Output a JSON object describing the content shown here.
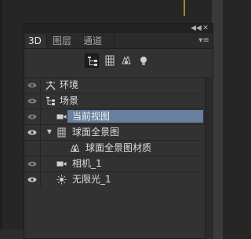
{
  "colors": {
    "background": "#262626",
    "panel": "#323232",
    "selection": "#6a7f9d",
    "text": "#dedede"
  },
  "panel": {
    "collapse_icon": "collapse-icon",
    "close_icon": "close-icon",
    "menu_icon": "panel-menu-icon"
  },
  "tabs": [
    {
      "label": "3D",
      "active": true
    },
    {
      "label": "图层",
      "active": false
    },
    {
      "label": "通道",
      "active": false
    }
  ],
  "filters": [
    {
      "icon": "whole-scene-icon",
      "active": true
    },
    {
      "icon": "meshes-icon",
      "active": false
    },
    {
      "icon": "materials-icon",
      "active": false
    },
    {
      "icon": "lights-icon",
      "active": false
    }
  ],
  "scene_items": [
    {
      "label": "环境",
      "icon": "environment-icon",
      "visible": true,
      "expanded": null,
      "selected": false
    },
    {
      "label": "场景",
      "icon": "scene-icon",
      "visible": true,
      "expanded": null,
      "selected": false
    },
    {
      "label": "当前视图",
      "icon": "camera-icon",
      "visible": true,
      "expanded": null,
      "selected": true
    },
    {
      "label": "球面全景图",
      "icon": "mesh-icon",
      "visible": true,
      "expanded": true,
      "selected": false
    },
    {
      "label": "球面全景图材质",
      "icon": "material-icon",
      "visible": false,
      "expanded": null,
      "selected": false
    },
    {
      "label": "相机_1",
      "icon": "camera-icon",
      "visible": true,
      "expanded": null,
      "selected": false
    },
    {
      "label": "无限光_1",
      "icon": "infinite-light-icon",
      "visible": true,
      "expanded": null,
      "selected": false
    }
  ]
}
